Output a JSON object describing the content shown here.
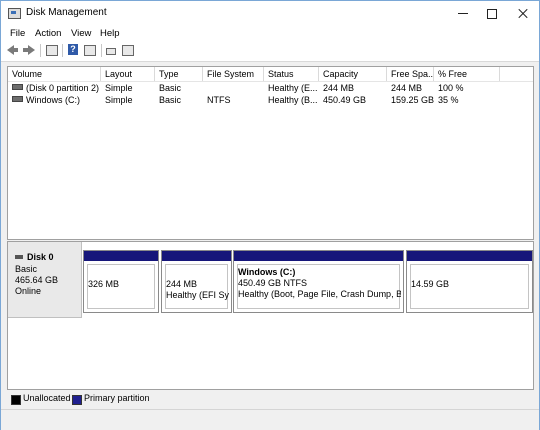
{
  "window": {
    "title": "Disk Management"
  },
  "menu": [
    "File",
    "Action",
    "View",
    "Help"
  ],
  "toolbar": {
    "icons": [
      "back-arrow-icon",
      "forward-arrow-icon",
      "properties-icon",
      "help-icon",
      "view-icon",
      "connect-icon",
      "settings-icon"
    ]
  },
  "volumes": {
    "columns": [
      "Volume",
      "Layout",
      "Type",
      "File System",
      "Status",
      "Capacity",
      "Free Spa...",
      "% Free"
    ],
    "rows": [
      [
        "(Disk 0 partition 2)",
        "Simple",
        "Basic",
        "",
        "Healthy (E...",
        "244 MB",
        "244 MB",
        "100 %"
      ],
      [
        "Windows (C:)",
        "Simple",
        "Basic",
        "NTFS",
        "Healthy (B...",
        "450.49 GB",
        "159.25 GB",
        "35 %"
      ]
    ]
  },
  "disk": {
    "name": "Disk 0",
    "type": "Basic",
    "size": "465.64 GB",
    "state": "Online",
    "partitions": [
      {
        "title": "",
        "line1": "326 MB",
        "line2": ""
      },
      {
        "title": "",
        "line1": "244 MB",
        "line2": "Healthy (EFI Syst"
      },
      {
        "title": "Windows (C:)",
        "line1": "450.49 GB NTFS",
        "line2": "Healthy (Boot, Page File, Crash Dump, Basic"
      },
      {
        "title": "",
        "line1": "14.59 GB",
        "line2": ""
      }
    ]
  },
  "legend": [
    {
      "label": "Unallocated",
      "color": "#000000"
    },
    {
      "label": "Primary partition",
      "color": "#1f1f8f"
    }
  ],
  "colors": {
    "partition_bar": "#16167a",
    "accent": "#1f1f8f"
  }
}
